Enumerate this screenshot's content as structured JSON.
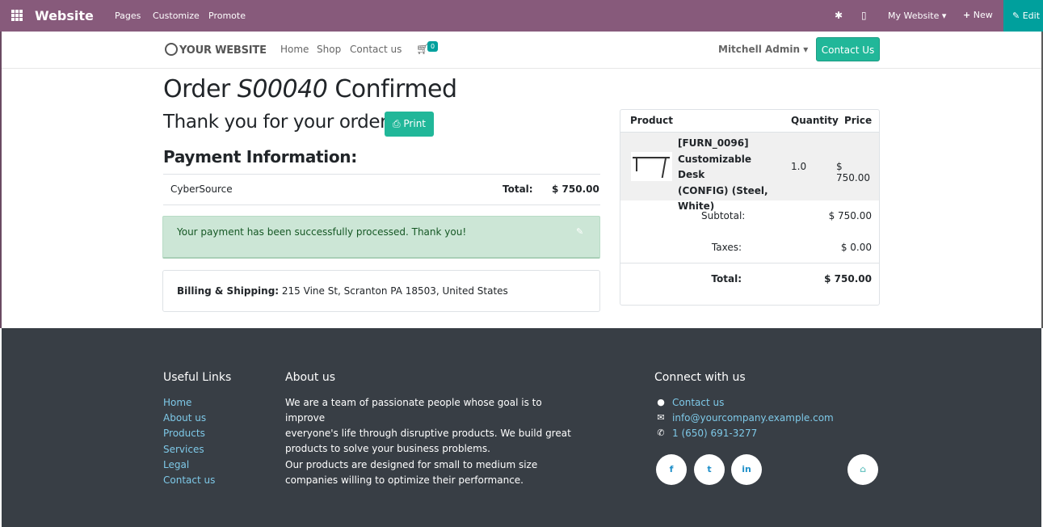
{
  "topbar": {
    "brand": "Website",
    "menu": [
      "Pages",
      "Customize",
      "Promote"
    ],
    "debug_icon": "bug-icon",
    "mobile_icon": "mobile-icon",
    "my_website": "My Website",
    "new_label": "New",
    "edit_label": "Edit"
  },
  "navbar": {
    "logo": "YOUR WEBSITE",
    "links": [
      "Home",
      "Shop",
      "Contact us"
    ],
    "cart_count": "0",
    "user": "Mitchell Admin",
    "contact_button": "Contact Us"
  },
  "order": {
    "title_prefix": "Order ",
    "order_ref": "S00040",
    "title_suffix": " Confirmed",
    "thanks": "Thank you for your order.",
    "print_label": "Print",
    "payment_heading": "Payment Information:",
    "payment_method": "CyberSource",
    "total_label": "Total:",
    "total_value": "$ 750.00",
    "success_message": "Your payment has been successfully processed. Thank you!",
    "billing_label": "Billing & Shipping:",
    "billing_address": "215 Vine St, Scranton PA 18503, United States"
  },
  "cart": {
    "headers": {
      "product": "Product",
      "quantity": "Quantity",
      "price": "Price"
    },
    "item": {
      "name_lines": [
        "[FURN_0096]",
        "Customizable Desk",
        "(CONFIG) (Steel,",
        "White)"
      ],
      "quantity": "1.0",
      "price": "$ 750.00"
    },
    "subtotal_label": "Subtotal:",
    "subtotal_value": "$ 750.00",
    "taxes_label": "Taxes:",
    "taxes_value": "$ 0.00",
    "total_label": "Total:",
    "total_value": "$ 750.00"
  },
  "footer": {
    "useful_links_heading": "Useful Links",
    "useful_links": [
      "Home",
      "About us",
      "Products",
      "Services",
      "Legal",
      "Contact us"
    ],
    "about_heading": "About us",
    "about_p1": [
      "We are a team of passionate people whose goal is to improve",
      "everyone's life through disruptive products. We build great",
      "products to solve your business problems."
    ],
    "about_p2": [
      "Our products are designed for small to medium size",
      "companies willing to optimize their performance."
    ],
    "connect_heading": "Connect with us",
    "connect": [
      {
        "icon": "comment-icon",
        "text": "Contact us"
      },
      {
        "icon": "envelope-icon",
        "text": "info@yourcompany.example.com"
      },
      {
        "icon": "phone-icon",
        "text": "1 (650) 691-3277"
      }
    ],
    "social": [
      "facebook-icon",
      "twitter-icon",
      "linkedin-icon",
      "home-icon"
    ]
  },
  "colors": {
    "topbar": "#875a7b",
    "accent": "#00a09d",
    "button": "#21b799",
    "success_bg": "#cce6d6",
    "footer": "#383e45",
    "link": "#7ec9e8"
  }
}
